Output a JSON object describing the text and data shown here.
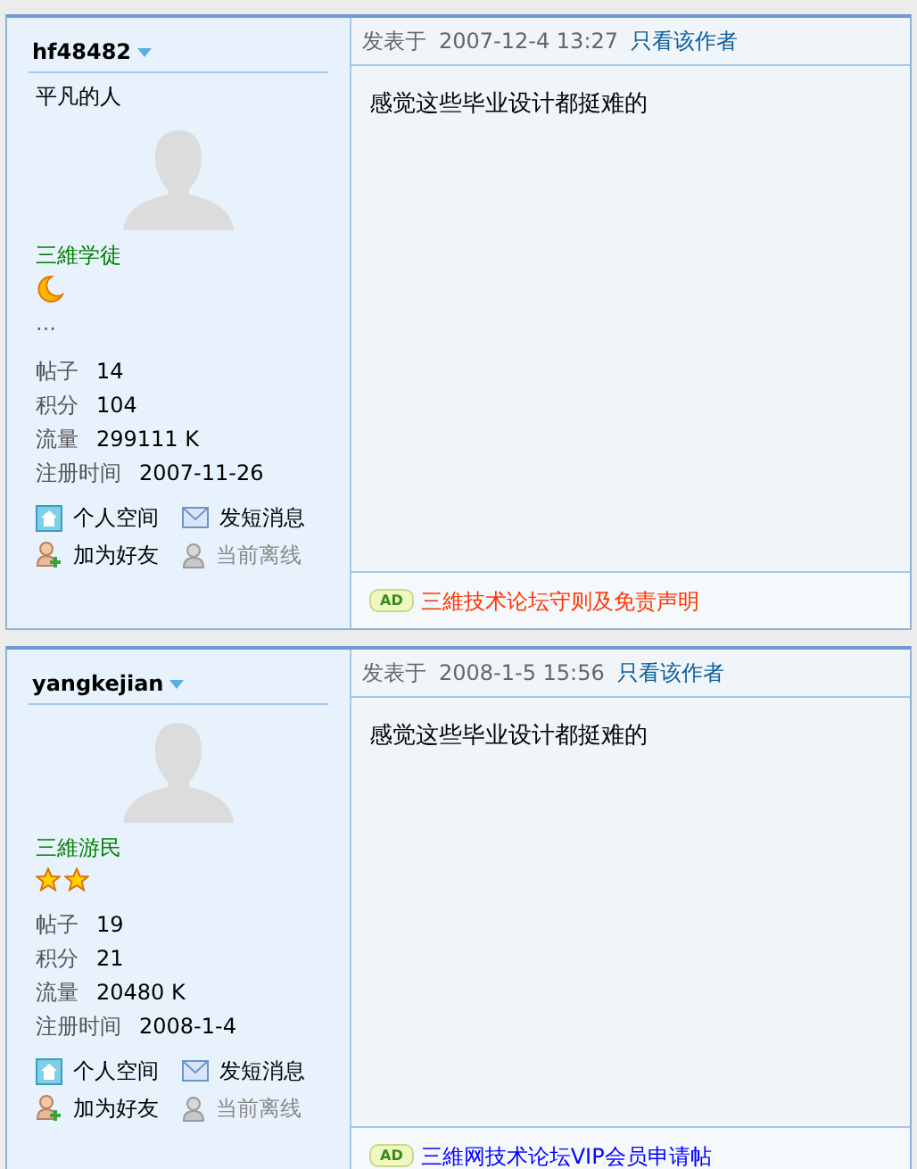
{
  "posts": [
    {
      "author": "hf48482",
      "custom_title": "平凡的人",
      "rank": "三維学徒",
      "rank_badges": [
        {
          "kind": "moon"
        }
      ],
      "signature": "...",
      "stats": [
        {
          "label": "帖子",
          "value": "14"
        },
        {
          "label": "积分",
          "value": "104"
        },
        {
          "label": "流量",
          "value": "299111 K"
        },
        {
          "label": "注册时间",
          "value": "2007-11-26"
        }
      ],
      "actions": [
        {
          "kind": "home",
          "label": "个人空间"
        },
        {
          "kind": "message",
          "label": "发短消息"
        },
        {
          "kind": "add-friend",
          "label": "加为好友"
        },
        {
          "kind": "offline",
          "label": "当前离线"
        }
      ],
      "posted_label": "发表于",
      "posted_time": "2007-12-4 13:27",
      "author_only_link": "只看该作者",
      "content": "感觉这些毕业设计都挺难的",
      "ad": {
        "badge": "AD",
        "text": "三維技术论坛守则及免责声明",
        "color": "#ff3300"
      }
    },
    {
      "author": "yangkejian",
      "rank": "三維游民",
      "rank_badges": [
        {
          "kind": "star"
        },
        {
          "kind": "star"
        }
      ],
      "stats": [
        {
          "label": "帖子",
          "value": "19"
        },
        {
          "label": "积分",
          "value": "21"
        },
        {
          "label": "流量",
          "value": "20480 K"
        },
        {
          "label": "注册时间",
          "value": "2008-1-4"
        }
      ],
      "actions": [
        {
          "kind": "home",
          "label": "个人空间"
        },
        {
          "kind": "message",
          "label": "发短消息"
        },
        {
          "kind": "add-friend",
          "label": "加为好友"
        },
        {
          "kind": "offline",
          "label": "当前离线"
        }
      ],
      "posted_label": "发表于",
      "posted_time": "2008-1-5 15:56",
      "author_only_link": "只看该作者",
      "content": "感觉这些毕业设计都挺难的",
      "ad": {
        "badge": "AD",
        "text": "三維网技术论坛VIP会员申请帖",
        "color": "#0000ff"
      }
    }
  ]
}
